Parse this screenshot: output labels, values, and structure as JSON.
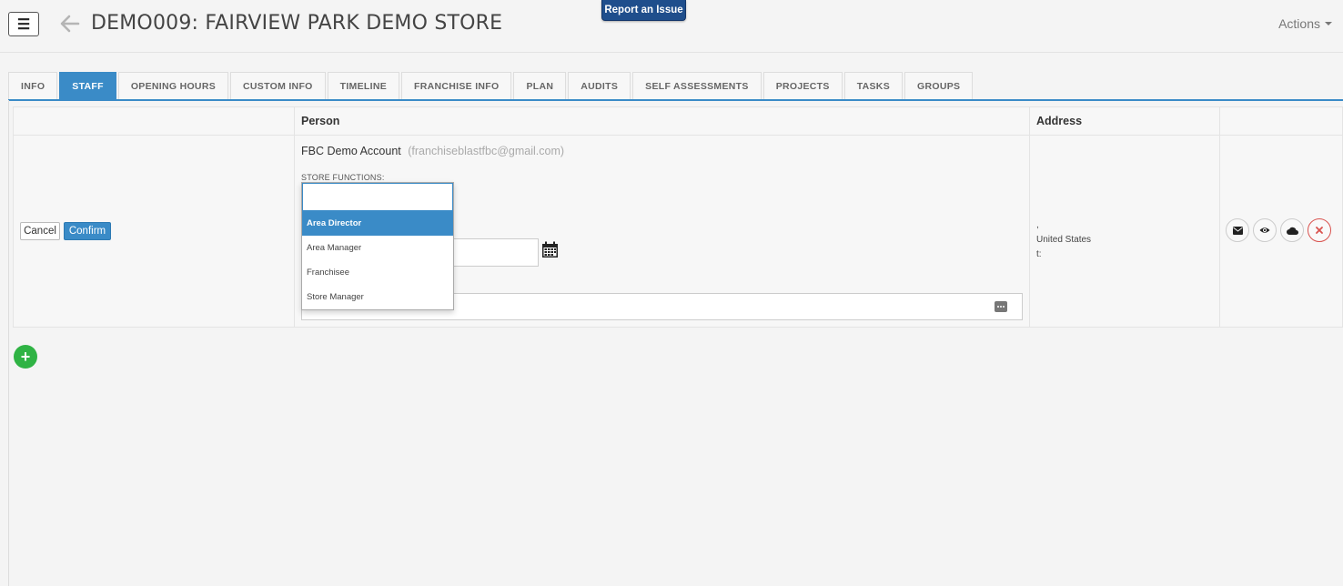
{
  "header": {
    "menu_icon": "hamburger-icon",
    "back_icon": "arrow-left-icon",
    "title": "DEMO009: FAIRVIEW PARK DEMO STORE",
    "report_label": "Report an Issue",
    "actions_label": "Actions"
  },
  "tabs": [
    {
      "label": "INFO",
      "active": false
    },
    {
      "label": "STAFF",
      "active": true
    },
    {
      "label": "OPENING HOURS",
      "active": false
    },
    {
      "label": "CUSTOM INFO",
      "active": false
    },
    {
      "label": "TIMELINE",
      "active": false
    },
    {
      "label": "FRANCHISE INFO",
      "active": false
    },
    {
      "label": "PLAN",
      "active": false
    },
    {
      "label": "AUDITS",
      "active": false
    },
    {
      "label": "SELF ASSESSMENTS",
      "active": false
    },
    {
      "label": "PROJECTS",
      "active": false
    },
    {
      "label": "TASKS",
      "active": false
    },
    {
      "label": "GROUPS",
      "active": false
    }
  ],
  "table": {
    "headers": [
      "",
      "Person",
      "Address",
      ""
    ],
    "row": {
      "cancel_label": "Cancel",
      "confirm_label": "Confirm",
      "person_name": "FBC Demo Account",
      "person_email": "(franchiseblastfbc@gmail.com)",
      "store_functions_label": "STORE FUNCTIONS:",
      "search_value": "",
      "dropdown_options": [
        {
          "label": "Area Director",
          "selected": true
        },
        {
          "label": "Area Manager",
          "selected": false
        },
        {
          "label": "Franchisee",
          "selected": false
        },
        {
          "label": "Store Manager",
          "selected": false
        }
      ],
      "address_line1": ",",
      "address_line2": "United States",
      "address_line3": "t:",
      "action_icons": [
        "envelope-icon",
        "eye-icon",
        "cloud-icon",
        "close-icon"
      ]
    }
  },
  "add_label": "+",
  "colors": {
    "accent": "#3a8bc7",
    "report_bg": "#1f4e8c",
    "add_green": "#2fb344",
    "danger": "#d9534f"
  }
}
